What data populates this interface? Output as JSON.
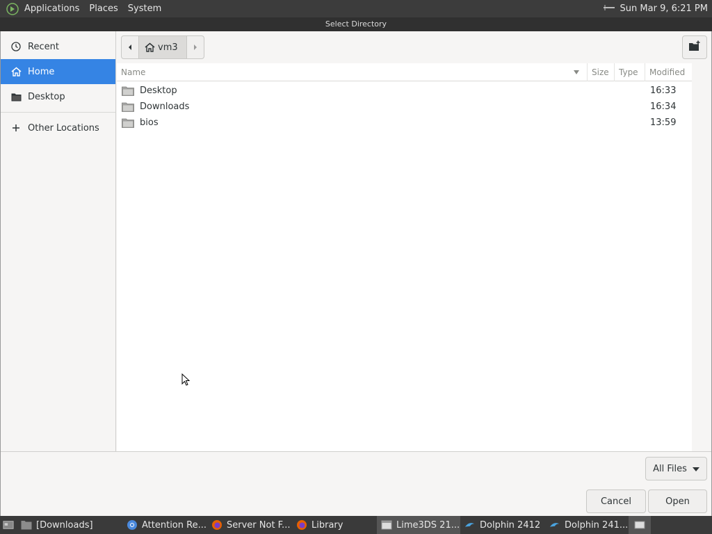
{
  "top_panel": {
    "menu": [
      "Applications",
      "Places",
      "System"
    ],
    "clock": "Sun Mar  9,  6:21 PM"
  },
  "dialog": {
    "title": "Select Directory",
    "sidebar": [
      {
        "label": "Recent",
        "icon": "clock-icon"
      },
      {
        "label": "Home",
        "icon": "home-icon",
        "active": true
      },
      {
        "label": "Desktop",
        "icon": "folder-icon"
      },
      {
        "label": "Other Locations",
        "icon": "plus-icon"
      }
    ],
    "path": {
      "current": "vm3"
    },
    "columns": {
      "name": "Name",
      "size": "Size",
      "type": "Type",
      "modified": "Modified"
    },
    "files": [
      {
        "name": "Desktop",
        "modified": "16:33"
      },
      {
        "name": "Downloads",
        "modified": "16:34"
      },
      {
        "name": "bios",
        "modified": "13:59"
      }
    ],
    "filter": "All Files",
    "cancel_label": "Cancel",
    "open_label": "Open"
  },
  "taskbar": {
    "items": [
      {
        "label": "[Downloads]",
        "icon": "folder-icon"
      },
      {
        "label": "Attention Re...",
        "icon": "chrome-icon"
      },
      {
        "label": "Server Not F...",
        "icon": "firefox-icon"
      },
      {
        "label": "Library",
        "icon": "firefox-icon"
      },
      {
        "label": "Lime3DS 21...",
        "icon": "window-icon",
        "active": true
      },
      {
        "label": "Dolphin 2412",
        "icon": "dolphin-icon"
      },
      {
        "label": "Dolphin 241...",
        "icon": "dolphin-icon"
      }
    ]
  },
  "colors": {
    "accent": "#3584e4",
    "panel": "#3c3c3c"
  }
}
